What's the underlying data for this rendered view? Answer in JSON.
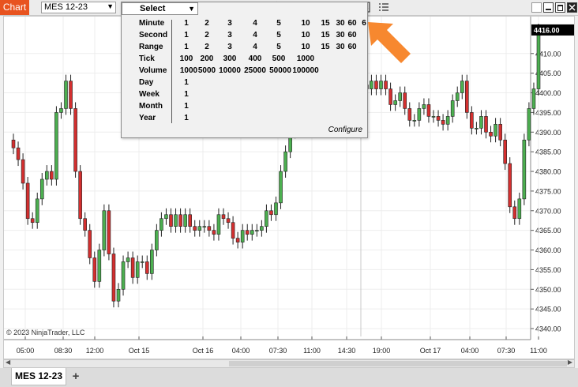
{
  "titlebar": {
    "chart_tab_label": "Chart",
    "instrument": "MES 12-23",
    "toolbar_icons": [
      "bar-type-icon",
      "pencil-draw-icon",
      "zoom-in-icon",
      "zoom-out-icon",
      "cursor-icon",
      "properties-icon",
      "data-box-icon",
      "strategies-icon",
      "indicators-icon",
      "templates-icon",
      "more-options-icon"
    ],
    "window_buttons": [
      "minimize-icon",
      "maximize-icon",
      "close-icon"
    ],
    "accent_color": "#e8531f"
  },
  "interval_menu": {
    "selected_label": "Select",
    "configure_label": "Configure",
    "rows": [
      {
        "label": "Minute",
        "values": [
          "1",
          "2",
          "3",
          "4",
          "5",
          "10",
          "15",
          "30",
          "60",
          "6"
        ]
      },
      {
        "label": "Second",
        "values": [
          "1",
          "2",
          "3",
          "4",
          "5",
          "10",
          "15",
          "30",
          "60"
        ]
      },
      {
        "label": "Range",
        "values": [
          "1",
          "2",
          "3",
          "4",
          "5",
          "10",
          "15",
          "30",
          "60"
        ]
      },
      {
        "label": "Tick",
        "values": [
          "100",
          "200",
          "300",
          "400",
          "500",
          "1000"
        ]
      },
      {
        "label": "Volume",
        "values": [
          "1000",
          "5000",
          "10000",
          "25000",
          "50000",
          "100000"
        ]
      },
      {
        "label": "Day",
        "values": [
          "1"
        ]
      },
      {
        "label": "Week",
        "values": [
          "1"
        ]
      },
      {
        "label": "Month",
        "values": [
          "1"
        ]
      },
      {
        "label": "Year",
        "values": [
          "1"
        ]
      }
    ]
  },
  "chart": {
    "copyright": "© 2023 NinjaTrader, LLC",
    "last_price_label": "4416.00",
    "up_color": "#4caf50",
    "down_color": "#d32f2f",
    "last_price_color": "#000000"
  },
  "chart_data": {
    "type": "candlestick",
    "y_ticks": [
      "4340.00",
      "4345.00",
      "4350.00",
      "4355.00",
      "4360.00",
      "4365.00",
      "4370.00",
      "4375.00",
      "4380.00",
      "4385.00",
      "4390.00",
      "4395.00",
      "4400.00",
      "4405.00",
      "4410.00",
      "4416.00"
    ],
    "x_ticks": [
      "05:00",
      "08:30",
      "12:00",
      "Oct 15",
      "Oct 16",
      "04:00",
      "07:30",
      "11:00",
      "14:30",
      "19:00",
      "Oct 17",
      "04:00",
      "07:30",
      "11:00"
    ],
    "ylim": [
      4338,
      4419
    ],
    "grid": true,
    "closes": [
      4386,
      4383,
      4377,
      4368,
      4367,
      4373,
      4378,
      4380,
      4378,
      4395,
      4396,
      4403,
      4396,
      4380,
      4368,
      4365,
      4358,
      4352,
      4360,
      4370,
      4359,
      4347,
      4350,
      4357,
      4358,
      4353,
      4357,
      4357,
      4354,
      4360,
      4365,
      4368,
      4369,
      4366,
      4369,
      4366,
      4369,
      4366,
      4365,
      4366,
      4366,
      4365,
      4364,
      4369,
      4368,
      4367,
      4363,
      4362,
      4365,
      4364,
      4365,
      4365,
      4366,
      4370,
      4369,
      4372,
      4380,
      4385,
      4390,
      4395,
      4400,
      4410,
      4418,
      4420,
      4418,
      4415,
      4412,
      4400,
      4405,
      4402,
      4398,
      4396,
      4400,
      4402,
      4401,
      4403,
      4401,
      4403,
      4401,
      4397,
      4398,
      4400,
      4396,
      4393,
      4393,
      4396,
      4397,
      4394,
      4394,
      4393,
      4392,
      4394,
      4398,
      4400,
      4403,
      4395,
      4391,
      4391,
      4394,
      4390,
      4389,
      4392,
      4388,
      4382,
      4371,
      4368,
      4373,
      4388,
      4396,
      4401,
      4416
    ],
    "series": []
  }
}
